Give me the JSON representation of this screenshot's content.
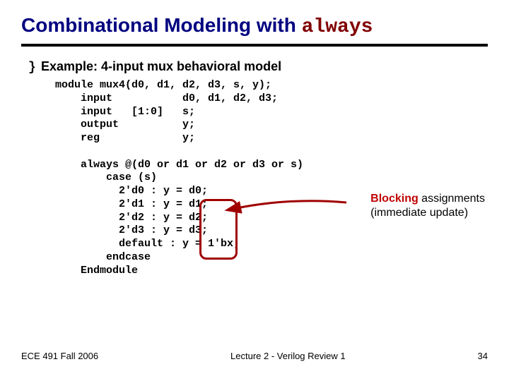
{
  "title": {
    "prefix": "Combinational Modeling with ",
    "keyword": "always"
  },
  "bullet": "Example: 4-input mux behavioral model",
  "bullet_icon": "}",
  "code": "module mux4(d0, d1, d2, d3, s, y);\n    input           d0, d1, d2, d3;\n    input   [1:0]   s;\n    output          y;\n    reg             y;\n\n    always @(d0 or d1 or d2 or d3 or s)\n        case (s)\n          2'd0 : y = d0;\n          2'd1 : y = d1;\n          2'd2 : y = d2;\n          2'd3 : y = d3;\n          default : y = 1'bx;\n        endcase\n    Endmodule",
  "annotation": {
    "line1_red": "Blocking",
    "line1_rest": " assignments",
    "line2": "(immediate update)"
  },
  "footer": {
    "left": "ECE 491 Fall 2006",
    "center": "Lecture 2 - Verilog Review 1",
    "right": "34"
  }
}
